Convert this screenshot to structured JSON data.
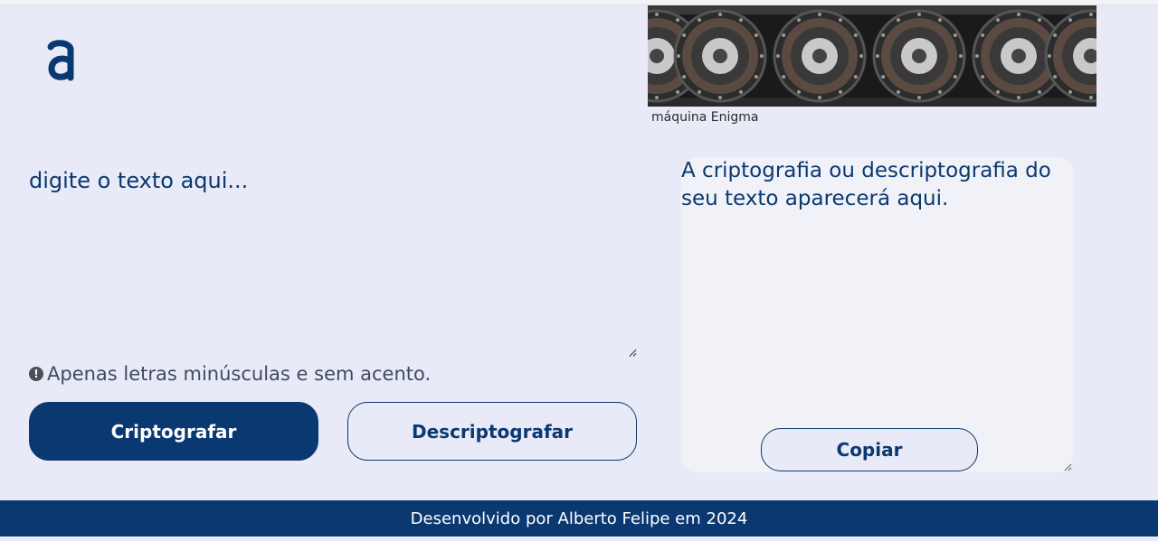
{
  "logo": {
    "icon": "alura-logo-icon",
    "color": "#0a3871"
  },
  "image": {
    "caption": "máquina Enigma"
  },
  "input": {
    "placeholder": "digite o texto aqui..."
  },
  "hint": {
    "text": "Apenas letras minúsculas e sem acento."
  },
  "buttons": {
    "encrypt": "Criptografar",
    "decrypt": "Descriptografar",
    "copy": "Copiar"
  },
  "output": {
    "text": "A criptografia ou descriptografia do seu texto aparecerá aqui."
  },
  "footer": {
    "text": "Desenvolvido por Alberto Felipe em 2024"
  },
  "colors": {
    "primary": "#0a3871",
    "background": "#e9eaf7",
    "panel": "#f1f2f8"
  }
}
